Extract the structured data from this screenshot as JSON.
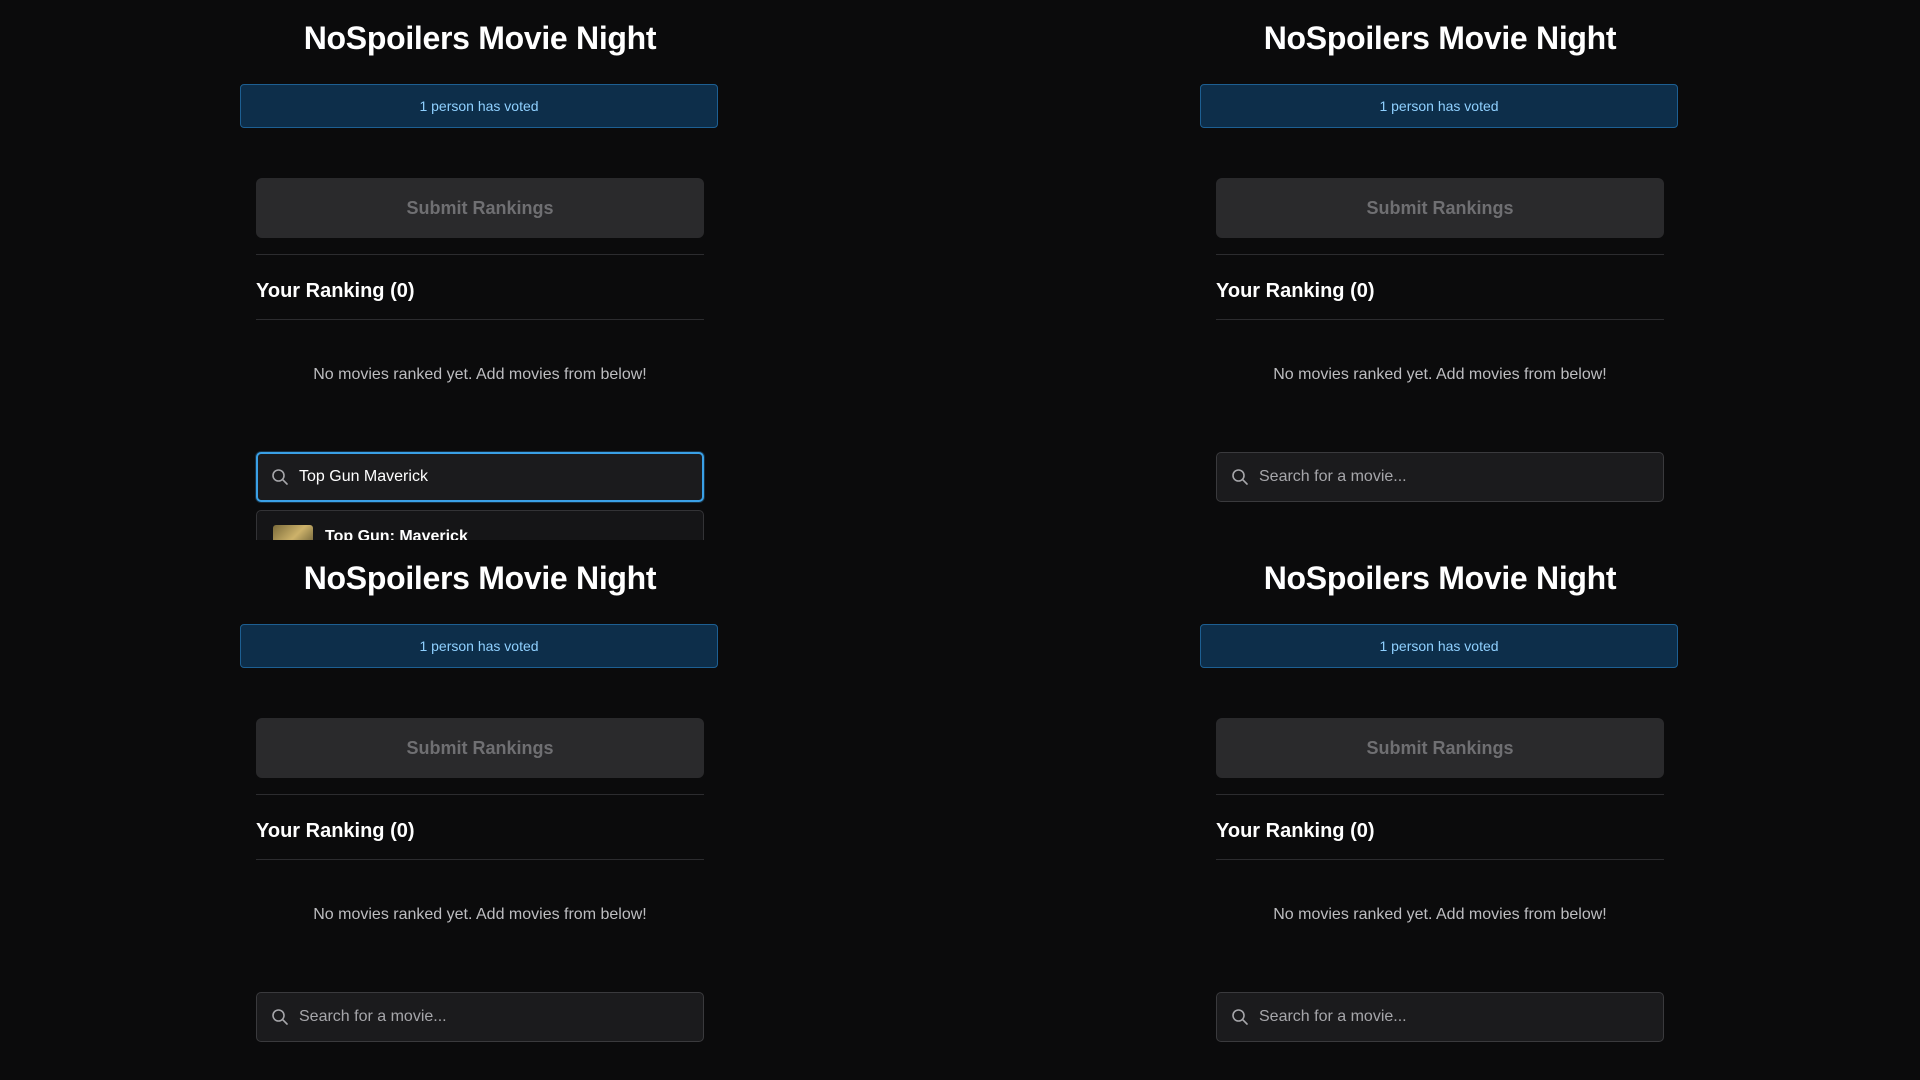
{
  "panels": [
    {
      "app_title": "NoSpoilers Movie Night",
      "vote_status": "1 person has voted",
      "submit_label": "Submit Rankings",
      "ranking_heading": "Your Ranking (0)",
      "empty_message": "No movies ranked yet. Add movies from below!",
      "search": {
        "value": "Top Gun Maverick",
        "placeholder": "Search for a movie...",
        "focused": true
      },
      "results": [
        {
          "title": "Top Gun: Maverick",
          "icon": "movie-poster-thumbnail"
        }
      ]
    },
    {
      "app_title": "NoSpoilers Movie Night",
      "vote_status": "1 person has voted",
      "submit_label": "Submit Rankings",
      "ranking_heading": "Your Ranking (0)",
      "empty_message": "No movies ranked yet. Add movies from below!",
      "search": {
        "value": "",
        "placeholder": "Search for a movie...",
        "focused": false
      }
    },
    {
      "app_title": "NoSpoilers Movie Night",
      "vote_status": "1 person has voted",
      "submit_label": "Submit Rankings",
      "ranking_heading": "Your Ranking (0)",
      "empty_message": "No movies ranked yet. Add movies from below!",
      "search": {
        "value": "",
        "placeholder": "Search for a movie...",
        "focused": false
      }
    },
    {
      "app_title": "NoSpoilers Movie Night",
      "vote_status": "1 person has voted",
      "submit_label": "Submit Rankings",
      "ranking_heading": "Your Ranking (0)",
      "empty_message": "No movies ranked yet. Add movies from below!",
      "search": {
        "value": "",
        "placeholder": "Search for a movie...",
        "focused": false
      }
    }
  ],
  "colors": {
    "background": "#0b0b0c",
    "banner_bg": "#0d2e4a",
    "banner_text": "#8fd0ff",
    "focus_ring": "#3aa0e6",
    "disabled_button": "#2a2a2c"
  },
  "icons": {
    "search": "magnifying-glass"
  }
}
